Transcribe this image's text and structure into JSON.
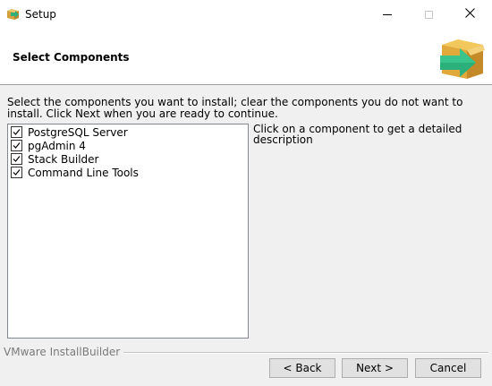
{
  "window": {
    "title": "Setup",
    "icon": "installer-box-icon"
  },
  "title_bar_controls": {
    "minimize": "minimize-icon",
    "maximize": "maximize-icon",
    "close": "close-icon",
    "close_glyph": "✕"
  },
  "header": {
    "title": "Select Components",
    "logo": "installer-box-arrow-icon"
  },
  "instructions": "Select the components you want to install; clear the components you do not want to install. Click Next when you are ready to continue.",
  "components": [
    {
      "label": "PostgreSQL Server",
      "checked": true
    },
    {
      "label": "pgAdmin 4",
      "checked": true
    },
    {
      "label": "Stack Builder",
      "checked": true
    },
    {
      "label": "Command Line Tools",
      "checked": true
    }
  ],
  "description": "Click on a component to get a detailed description",
  "footer": {
    "brand": "VMware InstallBuilder",
    "back_label": "< Back",
    "next_label": "Next >",
    "cancel_label": "Cancel"
  }
}
